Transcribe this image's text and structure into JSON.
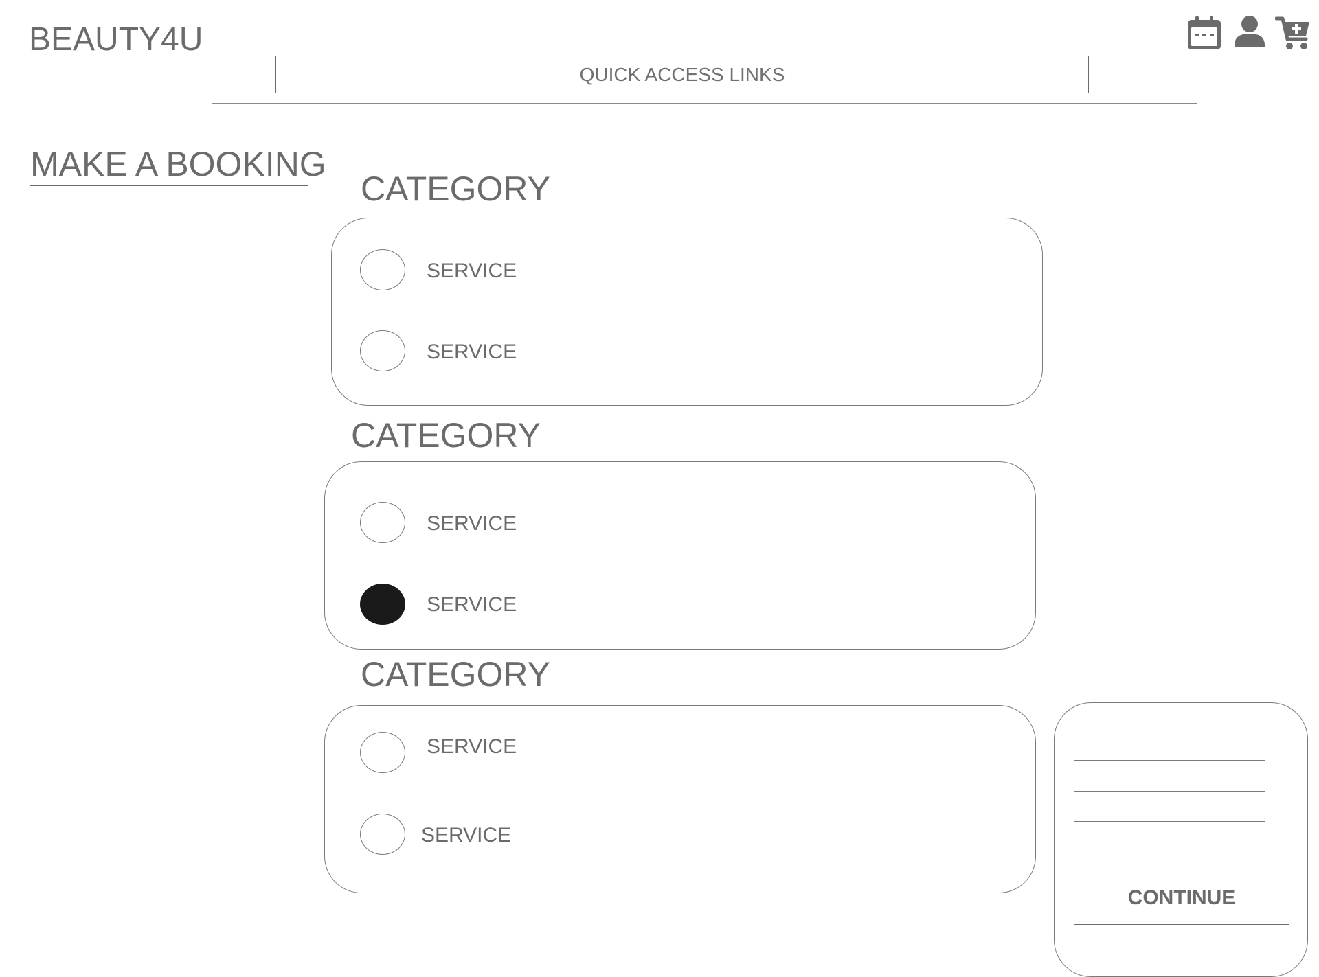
{
  "header": {
    "brand": "BEAUTY4U",
    "quick_links": "QUICK ACCESS LINKS",
    "icons": [
      "calendar-icon",
      "user-icon",
      "cart-add-icon"
    ]
  },
  "page": {
    "title": "MAKE A BOOKING"
  },
  "categories": [
    {
      "heading": "CATEGORY",
      "services": [
        {
          "label": "SERVICE",
          "selected": false
        },
        {
          "label": "SERVICE",
          "selected": false
        }
      ]
    },
    {
      "heading": "CATEGORY",
      "services": [
        {
          "label": "SERVICE",
          "selected": false
        },
        {
          "label": "SERVICE",
          "selected": true
        }
      ]
    },
    {
      "heading": "CATEGORY",
      "services": [
        {
          "label": "SERVICE",
          "selected": false
        },
        {
          "label": "SERVICE",
          "selected": false
        }
      ]
    }
  ],
  "summary": {
    "continue_label": "CONTINUE"
  },
  "colors": {
    "text": "#6b6b6b",
    "border": "#7a7a7a",
    "selected": "#1a1a1a"
  }
}
